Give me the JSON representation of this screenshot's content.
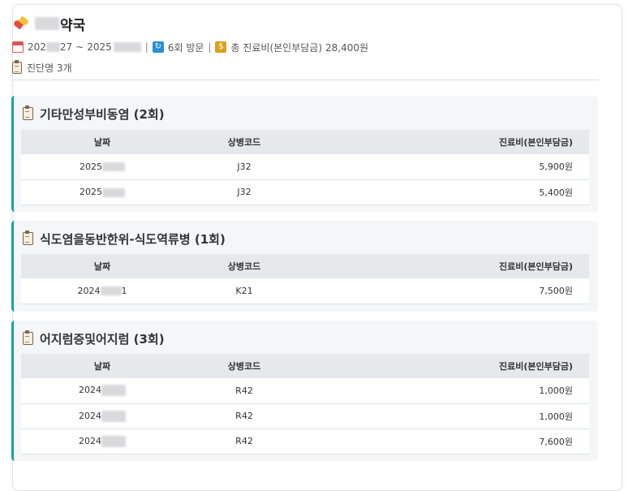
{
  "pharmacy": {
    "name_visible": "약국",
    "icon": "pill-icon"
  },
  "summary": {
    "date_start_visible": "202",
    "date_start_tail": "27",
    "date_range_sep": "~",
    "date_end_visible": "2025",
    "visits_text": "6회 방문",
    "total_label": "총 진료비(본인부담금)",
    "total_value": "28,400원",
    "diagnosis_count": "진단명 3개",
    "separator": "|"
  },
  "columns": {
    "date": "날짜",
    "code": "상병코드",
    "amount": "진료비(본인부담금)"
  },
  "diagnoses": [
    {
      "title": "기타만성부비동염 (2회)",
      "rows": [
        {
          "date_prefix": "2025",
          "date_tail": "",
          "code": "J32",
          "amount": "5,900원"
        },
        {
          "date_prefix": "2025",
          "date_tail": "",
          "code": "J32",
          "amount": "5,400원"
        }
      ]
    },
    {
      "title": "식도염을동반한위-식도역류병 (1회)",
      "rows": [
        {
          "date_prefix": "2024",
          "date_tail": "1",
          "code": "K21",
          "amount": "7,500원"
        }
      ]
    },
    {
      "title": "어지럼증및어지럼 (3회)",
      "rows": [
        {
          "date_prefix": "2024",
          "date_tail": "",
          "code": "R42",
          "amount": "1,000원"
        },
        {
          "date_prefix": "2024",
          "date_tail": "",
          "code": "R42",
          "amount": "1,000원"
        },
        {
          "date_prefix": "2024",
          "date_tail": "",
          "code": "R42",
          "amount": "7,600원"
        }
      ]
    }
  ],
  "colors": {
    "accent": "#17a2b8",
    "section_bg": "#f5f6f8",
    "header_bg": "#e6e8eb"
  }
}
